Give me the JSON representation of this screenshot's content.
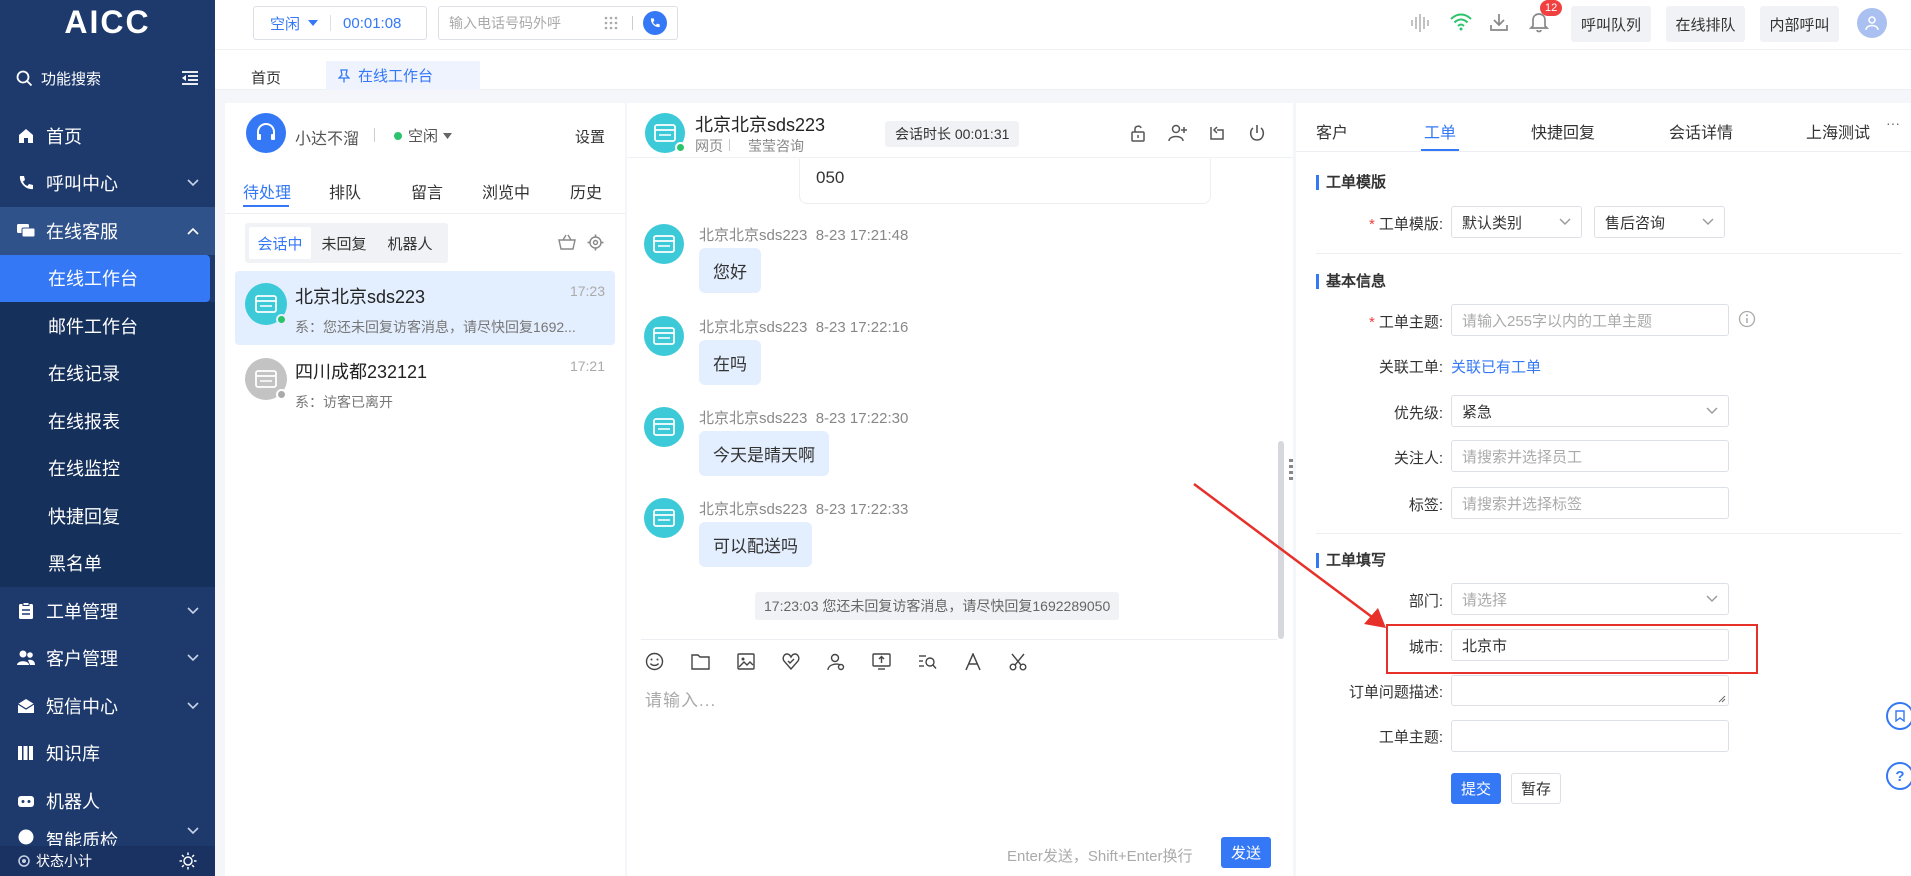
{
  "app": {
    "logo": "AICC"
  },
  "sidebar": {
    "search_label": "功能搜索",
    "items": [
      {
        "label": "首页"
      },
      {
        "label": "呼叫中心"
      },
      {
        "label": "在线客服"
      },
      {
        "label": "工单管理"
      },
      {
        "label": "客户管理"
      },
      {
        "label": "短信中心"
      },
      {
        "label": "知识库"
      },
      {
        "label": "机器人"
      },
      {
        "label": "智能质检"
      }
    ],
    "sub_items": [
      {
        "label": "在线工作台"
      },
      {
        "label": "邮件工作台"
      },
      {
        "label": "在线记录"
      },
      {
        "label": "在线报表"
      },
      {
        "label": "在线监控"
      },
      {
        "label": "快捷回复"
      },
      {
        "label": "黑名单"
      }
    ],
    "footer_label": "状态小计"
  },
  "topbar": {
    "agent_status": "空闲",
    "timer": "00:01:08",
    "dial_placeholder": "输入电话号码外呼",
    "notification_count": "12",
    "buttons": [
      "呼叫队列",
      "在线排队",
      "内部呼叫"
    ]
  },
  "tabs": [
    "首页",
    "在线工作台"
  ],
  "left_panel": {
    "agent_name": "小达不溜",
    "agent_status": "空闲",
    "settings_label": "设置",
    "tabs": [
      "待处理",
      "排队",
      "留言",
      "浏览中",
      "历史"
    ],
    "filters": [
      "会话中",
      "未回复",
      "机器人"
    ],
    "conversations": [
      {
        "name": "北京北京sds223",
        "time": "17:23",
        "preview": "系：您还未回复访客消息，请尽快回复1692..."
      },
      {
        "name": "四川成都232121",
        "time": "17:21",
        "preview": "系：访客已离开"
      }
    ]
  },
  "chat": {
    "title": "北京北京sds223",
    "channel": "网页",
    "source": "莹莹咨询",
    "duration": "会话时长 00:01:31",
    "partial_bubble_tail": "050",
    "messages": [
      {
        "sender": "北京北京sds223",
        "time": "8-23 17:21:48",
        "text": "您好"
      },
      {
        "sender": "北京北京sds223",
        "time": "8-23 17:22:16",
        "text": "在吗"
      },
      {
        "sender": "北京北京sds223",
        "time": "8-23 17:22:30",
        "text": "今天是晴天啊"
      },
      {
        "sender": "北京北京sds223",
        "time": "8-23 17:22:33",
        "text": "可以配送吗"
      }
    ],
    "system_notice": "17:23:03 您还未回复访客消息，请尽快回复1692289050",
    "input_placeholder": "请输入...",
    "send_hint": "Enter发送，Shift+Enter换行",
    "send_label": "发送"
  },
  "right_panel": {
    "tabs": [
      "客户",
      "工单",
      "快捷回复",
      "会话详情",
      "上海测试"
    ],
    "more": "···",
    "sections": {
      "template": "工单模版",
      "basic": "基本信息",
      "fill": "工单填写"
    },
    "fields": {
      "template_label": "工单模版:",
      "template_value1": "默认类别",
      "template_value2": "售后咨询",
      "subject_label": "工单主题:",
      "subject_placeholder": "请输入255字以内的工单主题",
      "related_label": "关联工单:",
      "related_link": "关联已有工单",
      "priority_label": "优先级:",
      "priority_value": "紧急",
      "watcher_label": "关注人:",
      "watcher_placeholder": "请搜索并选择员工",
      "tag_label": "标签:",
      "tag_placeholder": "请搜索并选择标签",
      "dept_label": "部门:",
      "dept_placeholder": "请选择",
      "city_label": "城市:",
      "city_value": "北京市",
      "order_desc_label": "订单问题描述:",
      "subject2_label": "工单主题:"
    },
    "submit_label": "提交",
    "save_label": "暂存"
  },
  "colors": {
    "sidebar": "#1e3a6d",
    "accent": "#3478f6",
    "highlight": "#e8302a",
    "online": "#2bc36b",
    "avatar": "#3cc9d8"
  }
}
